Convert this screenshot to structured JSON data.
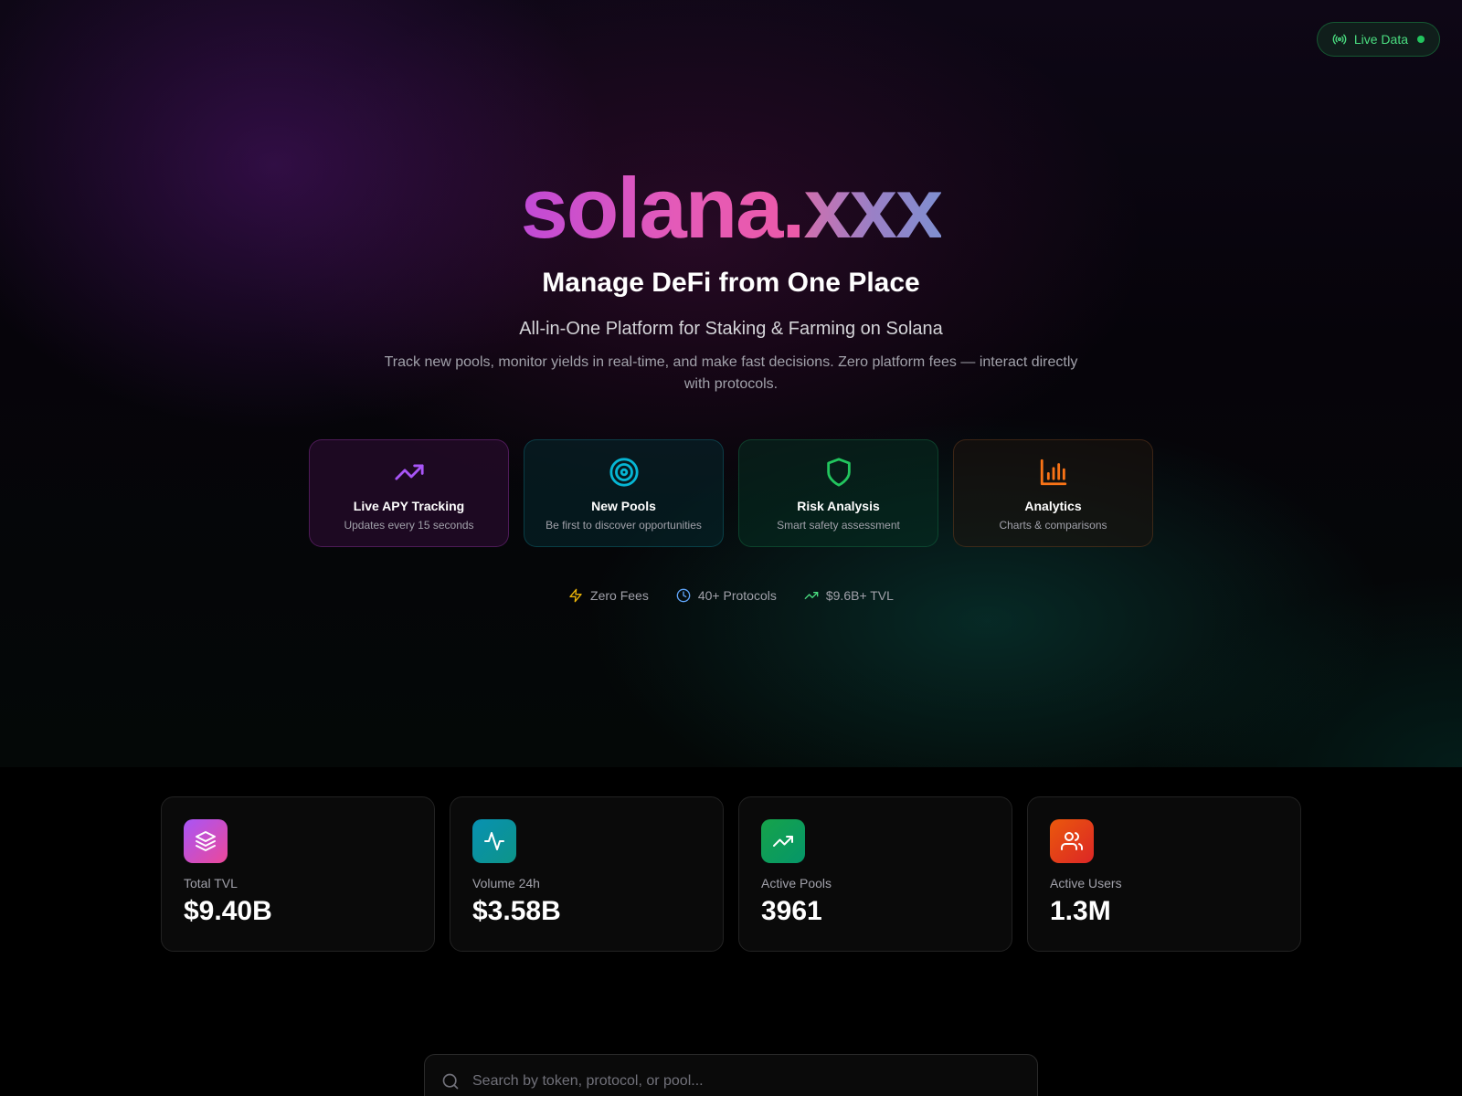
{
  "badge": {
    "label": "Live Data",
    "color": "#4ade80"
  },
  "hero": {
    "brand_part1": "solana.",
    "brand_part2": "xxx",
    "headline": "Manage DeFi from One Place",
    "subhead": "All-in-One Platform for Staking & Farming on Solana",
    "description": "Track new pools, monitor yields in real-time, and make fast decisions. Zero platform fees — interact directly with protocols."
  },
  "features": [
    {
      "title": "Live APY Tracking",
      "subtitle": "Updates every 15 seconds",
      "icon": "trending-up-icon",
      "color": "#a855f7"
    },
    {
      "title": "New Pools",
      "subtitle": "Be first to discover opportunities",
      "icon": "target-icon",
      "color": "#06b6d4"
    },
    {
      "title": "Risk Analysis",
      "subtitle": "Smart safety assessment",
      "icon": "shield-icon",
      "color": "#22c55e"
    },
    {
      "title": "Analytics",
      "subtitle": "Charts & comparisons",
      "icon": "bar-chart-icon",
      "color": "#f97316"
    }
  ],
  "quick_stats": [
    {
      "label": "Zero Fees",
      "icon": "lightning-icon",
      "color": "#eab308"
    },
    {
      "label": "40+ Protocols",
      "icon": "clock-icon",
      "color": "#60a5fa"
    },
    {
      "label": "$9.6B+ TVL",
      "icon": "trending-up-icon",
      "color": "#4ade80"
    }
  ],
  "stats": [
    {
      "label": "Total TVL",
      "value": "$9.40B",
      "icon": "layers-icon"
    },
    {
      "label": "Volume 24h",
      "value": "$3.58B",
      "icon": "activity-icon"
    },
    {
      "label": "Active Pools",
      "value": "3961",
      "icon": "trending-up-icon"
    },
    {
      "label": "Active Users",
      "value": "1.3M",
      "icon": "users-icon"
    }
  ],
  "search": {
    "placeholder": "Search by token, protocol, or pool..."
  }
}
